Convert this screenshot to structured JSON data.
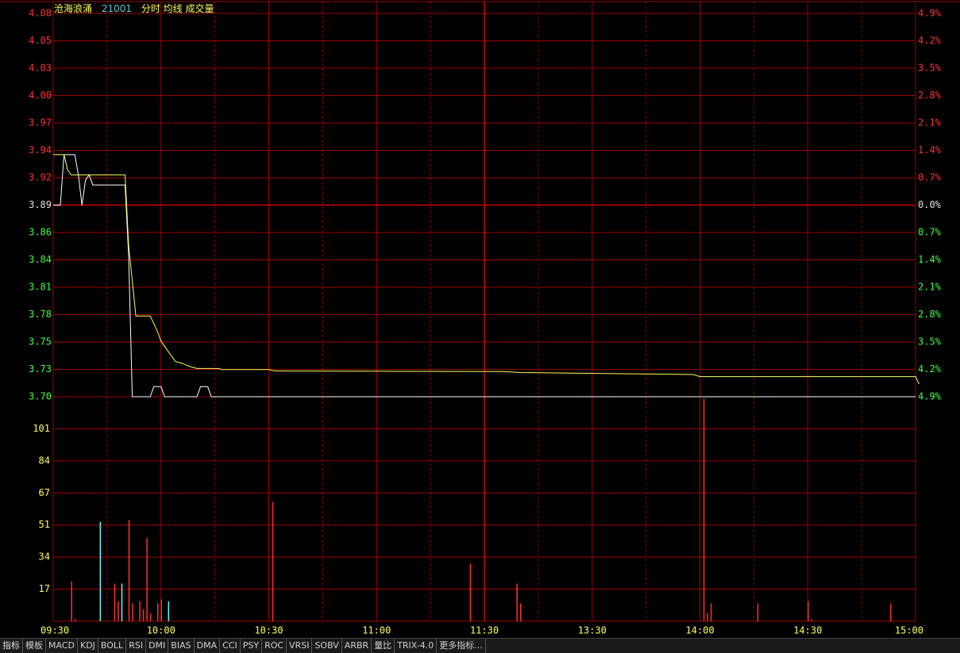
{
  "header": {
    "stock_name": "沧海浪涌",
    "stock_code": "21001",
    "mode_label": "分时 均线 成交量"
  },
  "tabs": [
    "指标",
    "模板",
    "MACD",
    "KDJ",
    "BOLL",
    "RSI",
    "DMI",
    "BIAS",
    "DMA",
    "CCI",
    "PSY",
    "ROC",
    "VRSI",
    "SOBV",
    "ARBR",
    "量比",
    "TRIX-4.0",
    "更多指标..."
  ],
  "colors": {
    "grid": "#a00000",
    "axis_up": "#ff3232",
    "axis_down": "#40ff40",
    "axis_flat": "#e0e0e0",
    "price_line": "#ffffff",
    "avg_line": "#ffff54",
    "vol_up": "#ff3030",
    "vol_down": "#54ffff",
    "vol_label": "#ffff54"
  },
  "chart_data": [
    {
      "type": "line",
      "name": "intraday-price",
      "pre_close": 3.89,
      "ylim": [
        3.7,
        4.08
      ],
      "y_ticks_left": [
        "4.08",
        "4.05",
        "4.03",
        "4.00",
        "3.97",
        "3.94",
        "3.92",
        "3.89",
        "3.86",
        "3.84",
        "3.81",
        "3.78",
        "3.75",
        "3.73",
        "3.70"
      ],
      "y_ticks_right": [
        "4.9%",
        "4.2%",
        "3.5%",
        "2.8%",
        "2.1%",
        "1.4%",
        "0.7%",
        "0.0%",
        "0.7%",
        "1.4%",
        "2.1%",
        "2.8%",
        "3.5%",
        "4.2%",
        "4.9%"
      ],
      "x_ticks": [
        "09:30",
        "10:00",
        "10:30",
        "11:00",
        "11:30",
        "13:30",
        "14:00",
        "14:30",
        "15:00"
      ],
      "minutes_total": 240,
      "series": [
        {
          "key": "price",
          "points": [
            [
              0,
              3.89
            ],
            [
              2,
              3.89
            ],
            [
              3,
              3.94
            ],
            [
              6,
              3.94
            ],
            [
              7,
              3.92
            ],
            [
              8,
              3.89
            ],
            [
              9,
              3.915
            ],
            [
              10,
              3.92
            ],
            [
              11,
              3.91
            ],
            [
              20,
              3.91
            ],
            [
              21,
              3.84
            ],
            [
              22,
              3.7
            ],
            [
              27,
              3.7
            ],
            [
              28,
              3.71
            ],
            [
              30,
              3.71
            ],
            [
              31,
              3.7
            ],
            [
              40,
              3.7
            ],
            [
              41,
              3.71
            ],
            [
              43,
              3.71
            ],
            [
              44,
              3.7
            ],
            [
              240,
              3.7
            ]
          ]
        },
        {
          "key": "average",
          "points": [
            [
              0,
              3.94
            ],
            [
              3,
              3.94
            ],
            [
              4,
              3.925
            ],
            [
              5,
              3.92
            ],
            [
              20,
              3.92
            ],
            [
              21,
              3.85
            ],
            [
              22,
              3.815
            ],
            [
              23,
              3.78
            ],
            [
              27,
              3.78
            ],
            [
              29,
              3.765
            ],
            [
              30,
              3.755
            ],
            [
              32,
              3.745
            ],
            [
              34,
              3.735
            ],
            [
              36,
              3.733
            ],
            [
              38,
              3.73
            ],
            [
              40,
              3.728
            ],
            [
              46,
              3.728
            ],
            [
              47,
              3.727
            ],
            [
              60,
              3.727
            ],
            [
              61,
              3.726
            ],
            [
              62,
              3.7255
            ],
            [
              125,
              3.725
            ],
            [
              130,
              3.724
            ],
            [
              178,
              3.722
            ],
            [
              180,
              3.72
            ],
            [
              240,
              3.72
            ],
            [
              241,
              3.7125
            ]
          ]
        }
      ]
    },
    {
      "type": "bar",
      "name": "volume",
      "ylim": [
        0,
        113
      ],
      "y_ticks": [
        "101",
        "84",
        "67",
        "51",
        "34",
        "17"
      ],
      "bars": [
        {
          "m": 5,
          "v": 20,
          "dir": "up"
        },
        {
          "m": 6,
          "v": 1,
          "dir": "up"
        },
        {
          "m": 13,
          "v": 50,
          "dir": "down"
        },
        {
          "m": 17,
          "v": 19,
          "dir": "up"
        },
        {
          "m": 18,
          "v": 10,
          "dir": "up"
        },
        {
          "m": 19,
          "v": 19,
          "dir": "down"
        },
        {
          "m": 21,
          "v": 51,
          "dir": "up"
        },
        {
          "m": 22,
          "v": 9,
          "dir": "up"
        },
        {
          "m": 24,
          "v": 10,
          "dir": "up"
        },
        {
          "m": 25,
          "v": 6,
          "dir": "up"
        },
        {
          "m": 26,
          "v": 42,
          "dir": "up"
        },
        {
          "m": 27,
          "v": 4,
          "dir": "up"
        },
        {
          "m": 29,
          "v": 9,
          "dir": "up"
        },
        {
          "m": 30,
          "v": 11,
          "dir": "up"
        },
        {
          "m": 32,
          "v": 10,
          "dir": "down"
        },
        {
          "m": 61,
          "v": 60,
          "dir": "up"
        },
        {
          "m": 116,
          "v": 29,
          "dir": "up"
        },
        {
          "m": 129,
          "v": 19,
          "dir": "up"
        },
        {
          "m": 130,
          "v": 9,
          "dir": "up"
        },
        {
          "m": 181,
          "v": 112,
          "dir": "up"
        },
        {
          "m": 182,
          "v": 4,
          "dir": "up"
        },
        {
          "m": 183,
          "v": 9,
          "dir": "up"
        },
        {
          "m": 196,
          "v": 9,
          "dir": "up"
        },
        {
          "m": 210,
          "v": 10,
          "dir": "up"
        },
        {
          "m": 211,
          "v": 1,
          "dir": "up"
        },
        {
          "m": 233,
          "v": 9,
          "dir": "up"
        }
      ]
    }
  ]
}
